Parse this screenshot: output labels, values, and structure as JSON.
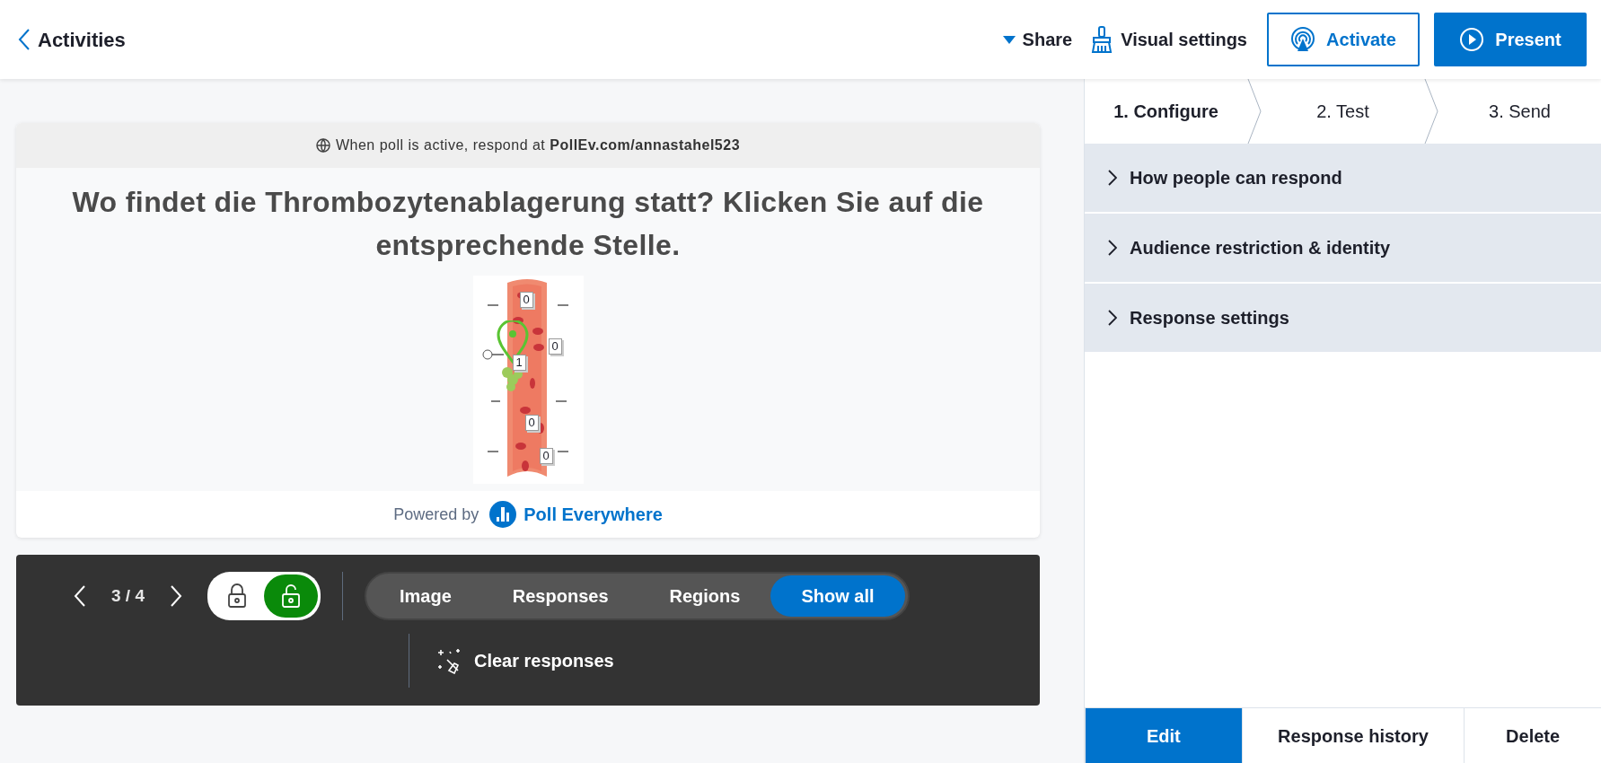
{
  "header": {
    "back_label": "Activities",
    "share": "Share",
    "visual_settings": "Visual settings",
    "activate": "Activate",
    "present": "Present"
  },
  "poll": {
    "respond_prefix": "When poll is active, respond at",
    "respond_url": "PollEv.com/annastahel523",
    "question": "Wo findet die Thrombozytenablagerung statt? Klicken Sie auf die entsprechende Stelle.",
    "regions": [
      {
        "count": "0",
        "pinned": false
      },
      {
        "count": "0",
        "pinned": false
      },
      {
        "count": "1",
        "pinned": true
      },
      {
        "count": "0",
        "pinned": false
      },
      {
        "count": "0",
        "pinned": false
      }
    ],
    "powered_by": "Powered by",
    "brand": "Poll Everywhere"
  },
  "toolbar": {
    "page": "3 / 4",
    "locked": false,
    "views": [
      {
        "label": "Image",
        "selected": false
      },
      {
        "label": "Responses",
        "selected": false
      },
      {
        "label": "Regions",
        "selected": false
      },
      {
        "label": "Show all",
        "selected": true
      }
    ],
    "clear": "Clear responses"
  },
  "steps": [
    {
      "label": "1. Configure",
      "selected": true
    },
    {
      "label": "2. Test",
      "selected": false
    },
    {
      "label": "3. Send",
      "selected": false
    }
  ],
  "sections": [
    {
      "label": "How people can respond",
      "expanded": false
    },
    {
      "label": "Audience restriction & identity",
      "expanded": false
    },
    {
      "label": "Response settings",
      "expanded": false
    }
  ],
  "actions": [
    {
      "label": "Edit",
      "kind": "primary"
    },
    {
      "label": "Response history",
      "kind": "plain"
    },
    {
      "label": "Delete",
      "kind": "plain"
    }
  ]
}
